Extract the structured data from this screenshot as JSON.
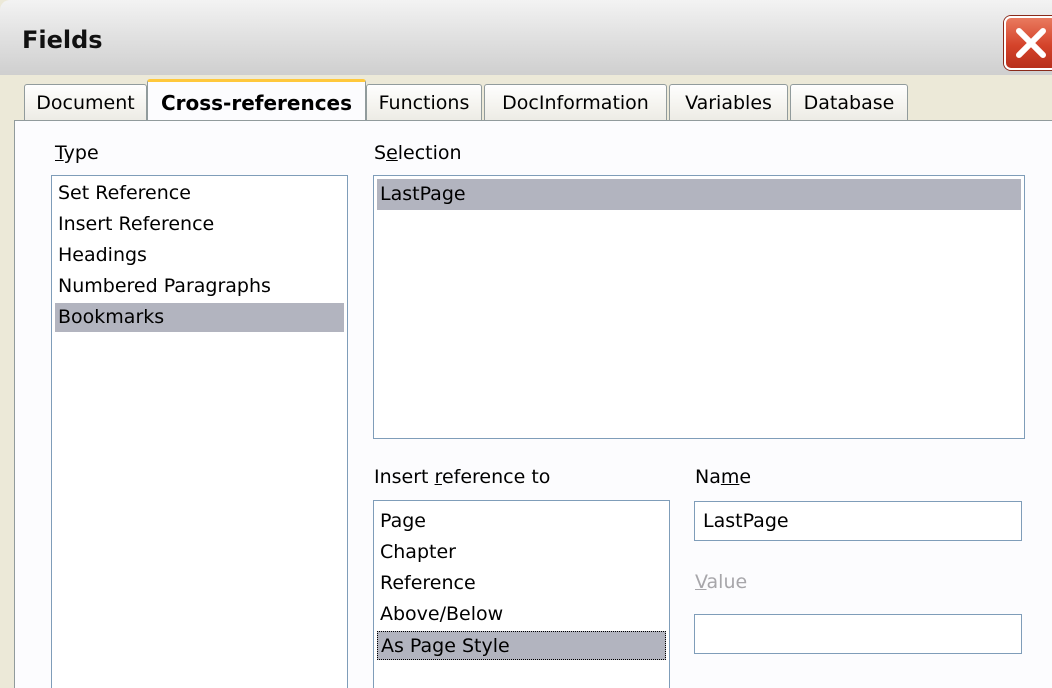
{
  "window": {
    "title": "Fields"
  },
  "tabs": [
    {
      "label": "Document",
      "active": false
    },
    {
      "label": "Cross-references",
      "active": true
    },
    {
      "label": "Functions",
      "active": false
    },
    {
      "label": "DocInformation",
      "active": false
    },
    {
      "label": "Variables",
      "active": false
    },
    {
      "label": "Database",
      "active": false
    }
  ],
  "type_panel": {
    "label_mnemonic": "T",
    "label_rest": "ype",
    "items": [
      "Set Reference",
      "Insert Reference",
      "Headings",
      "Numbered Paragraphs",
      "Bookmarks"
    ],
    "selected": "Bookmarks"
  },
  "selection_panel": {
    "label_pre": "S",
    "label_mnemonic": "e",
    "label_rest": "lection",
    "items": [
      "LastPage"
    ],
    "selected": "LastPage"
  },
  "insert_reference_panel": {
    "label_pre": "Insert ",
    "label_mnemonic": "r",
    "label_rest": "eference to",
    "items": [
      "Page",
      "Chapter",
      "Reference",
      "Above/Below",
      "As Page Style"
    ],
    "selected": "As Page Style"
  },
  "name_field": {
    "label_pre": "Na",
    "label_mnemonic": "m",
    "label_rest": "e",
    "value": "LastPage"
  },
  "value_field": {
    "label_mnemonic": "V",
    "label_rest": "alue",
    "value": ""
  },
  "colors": {
    "dialog_bg": "#ece9d8",
    "selection_highlight": "#b2b4bf",
    "active_tab_accent": "#ffc83c",
    "close_button": "#d4432a"
  }
}
